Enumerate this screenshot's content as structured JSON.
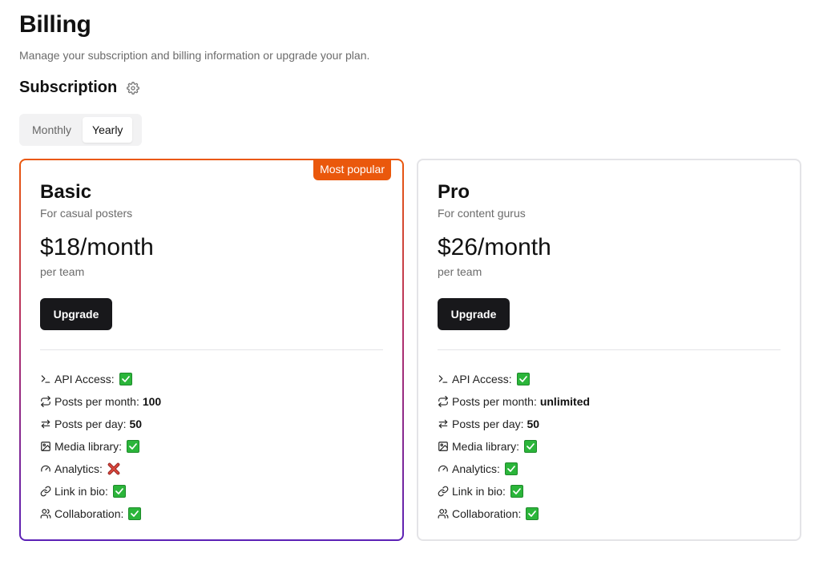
{
  "page": {
    "title": "Billing",
    "subtitle": "Manage your subscription and billing information or upgrade your plan."
  },
  "subscription": {
    "title": "Subscription",
    "icon": "gear-icon",
    "billing_toggle": {
      "options": [
        "Monthly",
        "Yearly"
      ],
      "selected": "Yearly"
    }
  },
  "plans": [
    {
      "name": "Basic",
      "description": "For casual posters",
      "price": "$18/month",
      "price_note": "per team",
      "button_label": "Upgrade",
      "badge": "Most popular",
      "features": [
        {
          "icon": "terminal-icon",
          "label": "API Access:",
          "value": "",
          "status": "check"
        },
        {
          "icon": "repeat-icon",
          "label": "Posts per month:",
          "value": "100",
          "status": ""
        },
        {
          "icon": "arrows-exchange-icon",
          "label": "Posts per day:",
          "value": "50",
          "status": ""
        },
        {
          "icon": "image-icon",
          "label": "Media library:",
          "value": "",
          "status": "check"
        },
        {
          "icon": "gauge-icon",
          "label": "Analytics:",
          "value": "",
          "status": "cross"
        },
        {
          "icon": "link-icon",
          "label": "Link in bio:",
          "value": "",
          "status": "check"
        },
        {
          "icon": "users-icon",
          "label": "Collaboration:",
          "value": "",
          "status": "check"
        }
      ]
    },
    {
      "name": "Pro",
      "description": "For content gurus",
      "price": "$26/month",
      "price_note": "per team",
      "button_label": "Upgrade",
      "badge": "",
      "features": [
        {
          "icon": "terminal-icon",
          "label": "API Access:",
          "value": "",
          "status": "check"
        },
        {
          "icon": "repeat-icon",
          "label": "Posts per month:",
          "value": "unlimited",
          "status": ""
        },
        {
          "icon": "arrows-exchange-icon",
          "label": "Posts per day:",
          "value": "50",
          "status": ""
        },
        {
          "icon": "image-icon",
          "label": "Media library:",
          "value": "",
          "status": "check"
        },
        {
          "icon": "gauge-icon",
          "label": "Analytics:",
          "value": "",
          "status": "check"
        },
        {
          "icon": "link-icon",
          "label": "Link in bio:",
          "value": "",
          "status": "check"
        },
        {
          "icon": "users-icon",
          "label": "Collaboration:",
          "value": "",
          "status": "check"
        }
      ]
    }
  ],
  "colors": {
    "badge": "#ea580c",
    "gradient_top": "#ea580c",
    "gradient_bottom": "#5b21b6",
    "button": "#18181b",
    "check": "#2bb53a",
    "cross": "#c0392b"
  }
}
